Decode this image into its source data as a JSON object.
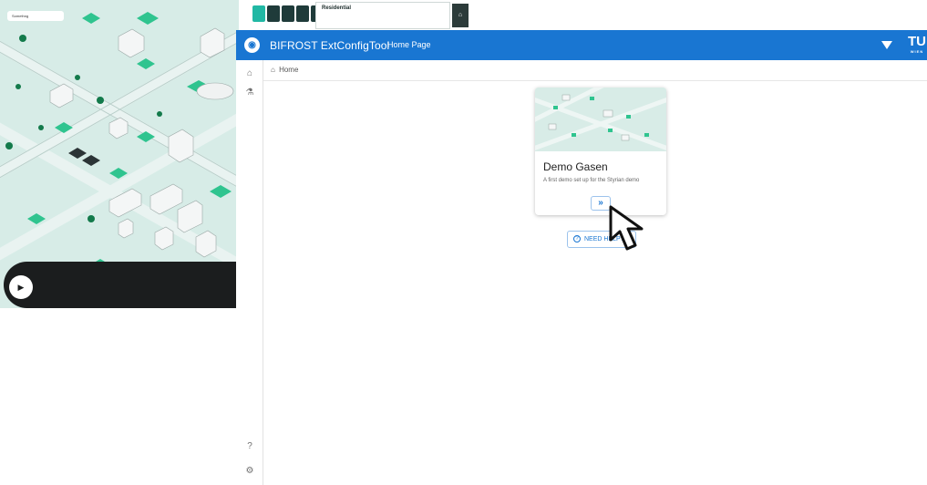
{
  "game": {
    "top_panel_label": "Residential",
    "select_value": "Somethng",
    "play_icon": "play-icon",
    "toolbar_icons": [
      "home-icon",
      "bolt-icon",
      "antenna-icon",
      "tower-icon",
      "person-icon"
    ]
  },
  "appbar": {
    "title": "BIFROST ExtConfigTool",
    "nav_label": "Home Page",
    "logo_right_main": "TU",
    "logo_right_sub": "WIEN",
    "color": "#1976d2"
  },
  "breadcrumb": {
    "label": "Home"
  },
  "card": {
    "title": "Demo Gasen",
    "description": "A first demo set up for the Styrian demo",
    "open_button_glyph": "»"
  },
  "help_button": {
    "label": "NEED HELP?"
  },
  "sidebar": {
    "icons": [
      "home-icon",
      "flask-icon",
      "help-icon",
      "settings-icon"
    ]
  }
}
